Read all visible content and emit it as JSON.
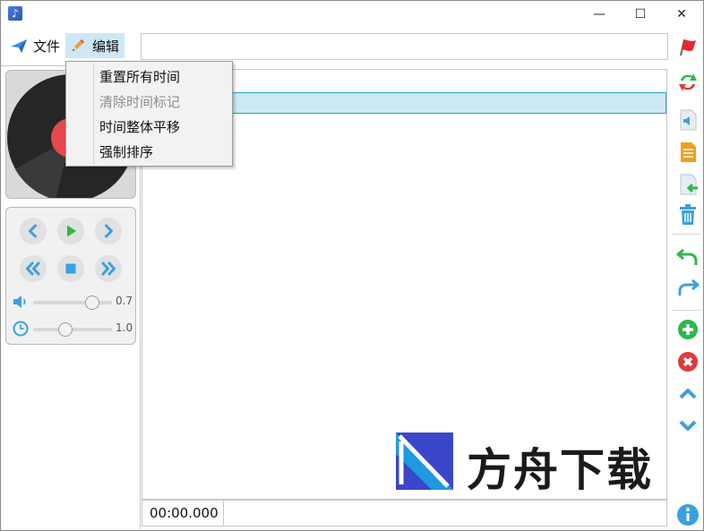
{
  "window": {
    "app_icon": "music-note-icon",
    "controls": {
      "minimize": "—",
      "maximize": "☐",
      "close": "✕"
    }
  },
  "menu": {
    "file": {
      "label": "文件",
      "icon": "paper-plane-icon"
    },
    "edit": {
      "label": "编辑",
      "icon": "pencil-icon"
    }
  },
  "url_input": {
    "value": ""
  },
  "edit_menu": {
    "items": [
      {
        "label": "重置所有时间",
        "enabled": true
      },
      {
        "label": "清除时间标记",
        "enabled": false
      },
      {
        "label": "时间整体平移",
        "enabled": true
      },
      {
        "label": "强制排序",
        "enabled": true
      }
    ]
  },
  "player": {
    "volume": {
      "icon": "speaker-icon",
      "value": "0.7",
      "level": 0.7
    },
    "speed": {
      "icon": "clock-icon",
      "value": "1.0"
    }
  },
  "status": {
    "time": "00:00.000",
    "info": ""
  },
  "toolbar": {
    "items": [
      "refresh-icon",
      "audio-file-icon",
      "document-icon",
      "import-file-icon",
      "trash-icon",
      "undo-icon",
      "redo-icon",
      "add-icon",
      "remove-icon",
      "move-up-icon",
      "move-down-icon",
      "info-icon"
    ]
  },
  "watermark": {
    "text": "方舟下载"
  },
  "colors": {
    "accent": "#26a0da",
    "selection": "#cce8f6",
    "play": "#2db84c",
    "control_blue": "#3aa0e0",
    "add": "#2db84c",
    "remove": "#e03a3a"
  }
}
